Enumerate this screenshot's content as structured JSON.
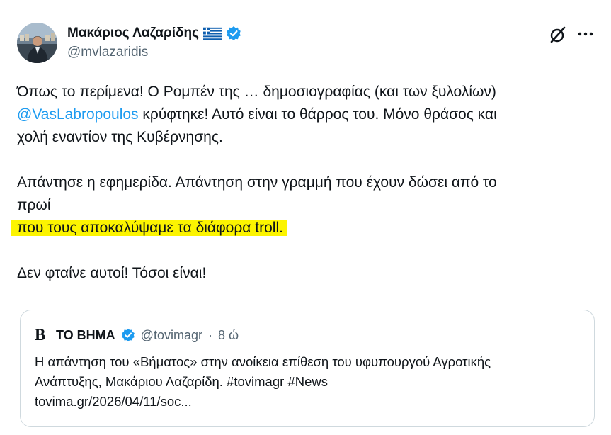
{
  "author": {
    "display_name": "Μακάριος Λαζαρίδης",
    "handle": "@mvlazaridis",
    "flag_icon": "greek-flag-icon",
    "verified_color": "#1d9bf0"
  },
  "tweet": {
    "line1": "Όπως το περίμενα! Ο Ρομπέν της … δημοσιογραφίας (και των ξυλολίων)",
    "mention": "@VasLabropoulos",
    "line2_rest": " κρύφτηκε! Αυτό είναι το θάρρος του. Μόνο θράσος και",
    "line3": "χολή εναντίον της Κυβέρνησης.",
    "line4": "Απάντησε η εφημερίδα. Απάντηση στην γραμμή που έχουν δώσει από το",
    "line5": "πρωί",
    "line6_highlighted": "που τους αποκαλύψαμε τα διάφορα troll.",
    "line7": "Δεν φταίνε αυτοί! Τόσοι είναι!",
    "highlight_color": "#fcf400",
    "mention_color": "#1d9bf0"
  },
  "quoted": {
    "logo_letter": "B",
    "name": "ΤΟ ΒΗΜΑ",
    "handle": "@tovimagr",
    "separator": "·",
    "time": "8 ώ",
    "line1": "Η απάντηση του «Βήματος» στην ανοίκεια επίθεση του υφυπουργού Αγροτικής",
    "line2": "Ανάπτυξης, Μακάριου Λαζαρίδη. #tovimagr #News",
    "line3": "tovima.gr/2026/04/11/soc..."
  },
  "icons": {
    "grok": "grok-icon",
    "more": "more-options-icon"
  }
}
